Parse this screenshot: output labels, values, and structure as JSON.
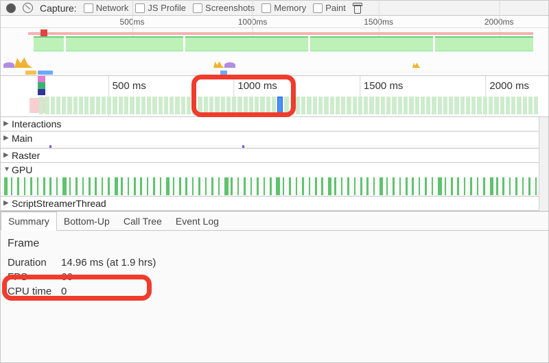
{
  "toolbar": {
    "capture_label": "Capture:",
    "options": [
      "Network",
      "JS Profile",
      "Screenshots",
      "Memory",
      "Paint"
    ]
  },
  "overview_ruler": {
    "ticks": [
      "500ms",
      "1000ms",
      "1500ms",
      "2000ms"
    ]
  },
  "main_ruler": {
    "ticks": [
      "500 ms",
      "1000 ms",
      "1500 ms",
      "2000 ms"
    ]
  },
  "sections": {
    "interactions": "Interactions",
    "main": "Main",
    "raster": "Raster",
    "gpu": "GPU",
    "script_streamer": "ScriptStreamerThread"
  },
  "tabs": [
    "Summary",
    "Bottom-Up",
    "Call Tree",
    "Event Log"
  ],
  "details": {
    "title": "Frame",
    "duration_label": "Duration",
    "duration_value": "14.96 ms (at 1.9 hrs)",
    "fps_label": "FPS",
    "fps_value": "66",
    "cpu_label": "CPU time",
    "cpu_value": "0"
  },
  "chart_data": {
    "type": "timeline",
    "unit": "ms",
    "range": [
      0,
      2100
    ],
    "major_ticks": [
      500,
      1000,
      1500,
      2000
    ],
    "selected_frame_at_ms": 1010,
    "selected_frame": {
      "duration_ms": 14.96,
      "fps": 66,
      "cpu_time_ms": 0
    }
  }
}
